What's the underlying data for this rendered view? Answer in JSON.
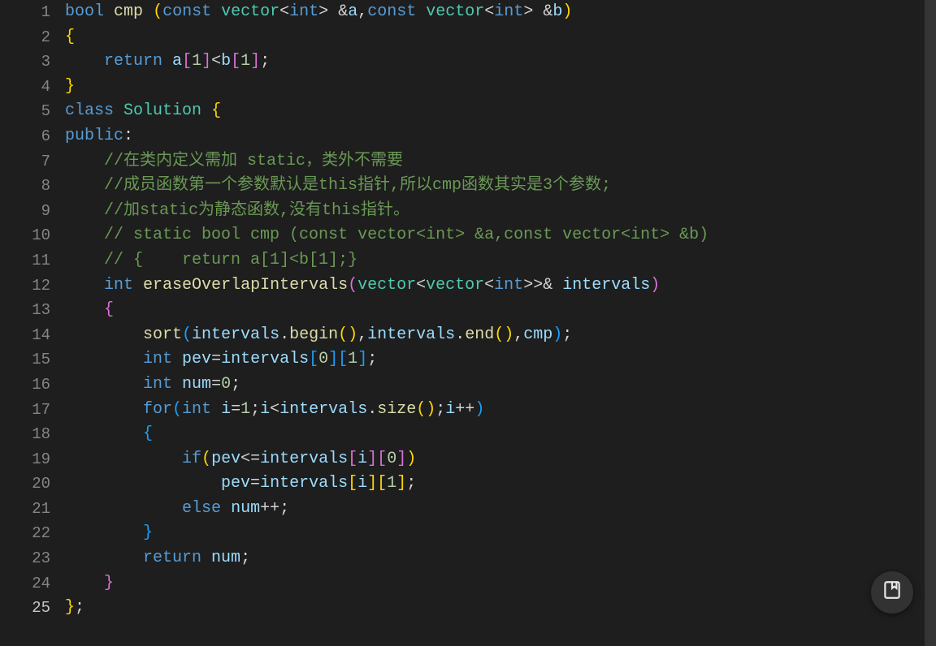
{
  "fab_icon": "bookmark-icon",
  "active_line": 25,
  "lines": [
    {
      "n": 1,
      "tokens": [
        {
          "t": "bool",
          "c": "kw"
        },
        {
          "t": " ",
          "c": "op"
        },
        {
          "t": "cmp",
          "c": "fn"
        },
        {
          "t": " ",
          "c": "op"
        },
        {
          "t": "(",
          "c": "br-y"
        },
        {
          "t": "const",
          "c": "kw"
        },
        {
          "t": " ",
          "c": "op"
        },
        {
          "t": "vector",
          "c": "type"
        },
        {
          "t": "<",
          "c": "op"
        },
        {
          "t": "int",
          "c": "kw"
        },
        {
          "t": ">",
          "c": "op"
        },
        {
          "t": " ",
          "c": "op"
        },
        {
          "t": "&",
          "c": "op"
        },
        {
          "t": "a",
          "c": "var"
        },
        {
          "t": ",",
          "c": "pun"
        },
        {
          "t": "const",
          "c": "kw"
        },
        {
          "t": " ",
          "c": "op"
        },
        {
          "t": "vector",
          "c": "type"
        },
        {
          "t": "<",
          "c": "op"
        },
        {
          "t": "int",
          "c": "kw"
        },
        {
          "t": ">",
          "c": "op"
        },
        {
          "t": " ",
          "c": "op"
        },
        {
          "t": "&",
          "c": "op"
        },
        {
          "t": "b",
          "c": "var"
        },
        {
          "t": ")",
          "c": "br-y"
        }
      ]
    },
    {
      "n": 2,
      "tokens": [
        {
          "t": "{",
          "c": "br-y"
        }
      ]
    },
    {
      "n": 3,
      "tokens": [
        {
          "t": "    ",
          "c": "op"
        },
        {
          "t": "return",
          "c": "kw"
        },
        {
          "t": " ",
          "c": "op"
        },
        {
          "t": "a",
          "c": "var"
        },
        {
          "t": "[",
          "c": "br-p"
        },
        {
          "t": "1",
          "c": "num"
        },
        {
          "t": "]",
          "c": "br-p"
        },
        {
          "t": "<",
          "c": "op"
        },
        {
          "t": "b",
          "c": "var"
        },
        {
          "t": "[",
          "c": "br-p"
        },
        {
          "t": "1",
          "c": "num"
        },
        {
          "t": "]",
          "c": "br-p"
        },
        {
          "t": ";",
          "c": "pun"
        }
      ]
    },
    {
      "n": 4,
      "tokens": [
        {
          "t": "}",
          "c": "br-y"
        }
      ]
    },
    {
      "n": 5,
      "tokens": [
        {
          "t": "class",
          "c": "kw"
        },
        {
          "t": " ",
          "c": "op"
        },
        {
          "t": "Solution",
          "c": "type"
        },
        {
          "t": " ",
          "c": "op"
        },
        {
          "t": "{",
          "c": "br-y"
        }
      ]
    },
    {
      "n": 6,
      "tokens": [
        {
          "t": "public",
          "c": "kw"
        },
        {
          "t": ":",
          "c": "pun"
        }
      ]
    },
    {
      "n": 7,
      "tokens": [
        {
          "t": "    ",
          "c": "op"
        },
        {
          "t": "//在类内定义需加 static，类外不需要",
          "c": "cmt"
        }
      ]
    },
    {
      "n": 8,
      "tokens": [
        {
          "t": "    ",
          "c": "op"
        },
        {
          "t": "//成员函数第一个参数默认是this指针,所以cmp函数其实是3个参数;",
          "c": "cmt"
        }
      ]
    },
    {
      "n": 9,
      "tokens": [
        {
          "t": "    ",
          "c": "op"
        },
        {
          "t": "//加static为静态函数,没有this指针。",
          "c": "cmt"
        }
      ]
    },
    {
      "n": 10,
      "tokens": [
        {
          "t": "    ",
          "c": "op"
        },
        {
          "t": "// static bool cmp (const vector<int> &a,const vector<int> &b)",
          "c": "cmt"
        }
      ]
    },
    {
      "n": 11,
      "tokens": [
        {
          "t": "    ",
          "c": "op"
        },
        {
          "t": "// {    return a[1]<b[1];}",
          "c": "cmt"
        }
      ]
    },
    {
      "n": 12,
      "tokens": [
        {
          "t": "    ",
          "c": "op"
        },
        {
          "t": "int",
          "c": "kw"
        },
        {
          "t": " ",
          "c": "op"
        },
        {
          "t": "eraseOverlapIntervals",
          "c": "fn"
        },
        {
          "t": "(",
          "c": "br-p"
        },
        {
          "t": "vector",
          "c": "type"
        },
        {
          "t": "<",
          "c": "op"
        },
        {
          "t": "vector",
          "c": "type"
        },
        {
          "t": "<",
          "c": "op"
        },
        {
          "t": "int",
          "c": "kw"
        },
        {
          "t": ">>",
          "c": "op"
        },
        {
          "t": "&",
          "c": "op"
        },
        {
          "t": " ",
          "c": "op"
        },
        {
          "t": "intervals",
          "c": "var"
        },
        {
          "t": ")",
          "c": "br-p"
        }
      ]
    },
    {
      "n": 13,
      "tokens": [
        {
          "t": "    ",
          "c": "op"
        },
        {
          "t": "{",
          "c": "br-p"
        }
      ]
    },
    {
      "n": 14,
      "tokens": [
        {
          "t": "        ",
          "c": "op"
        },
        {
          "t": "sort",
          "c": "fn"
        },
        {
          "t": "(",
          "c": "br-b"
        },
        {
          "t": "intervals",
          "c": "var"
        },
        {
          "t": ".",
          "c": "pun"
        },
        {
          "t": "begin",
          "c": "fn"
        },
        {
          "t": "(",
          "c": "br-y"
        },
        {
          "t": ")",
          "c": "br-y"
        },
        {
          "t": ",",
          "c": "pun"
        },
        {
          "t": "intervals",
          "c": "var"
        },
        {
          "t": ".",
          "c": "pun"
        },
        {
          "t": "end",
          "c": "fn"
        },
        {
          "t": "(",
          "c": "br-y"
        },
        {
          "t": ")",
          "c": "br-y"
        },
        {
          "t": ",",
          "c": "pun"
        },
        {
          "t": "cmp",
          "c": "var"
        },
        {
          "t": ")",
          "c": "br-b"
        },
        {
          "t": ";",
          "c": "pun"
        }
      ]
    },
    {
      "n": 15,
      "tokens": [
        {
          "t": "        ",
          "c": "op"
        },
        {
          "t": "int",
          "c": "kw"
        },
        {
          "t": " ",
          "c": "op"
        },
        {
          "t": "pev",
          "c": "var"
        },
        {
          "t": "=",
          "c": "op"
        },
        {
          "t": "intervals",
          "c": "var"
        },
        {
          "t": "[",
          "c": "br-b"
        },
        {
          "t": "0",
          "c": "num"
        },
        {
          "t": "]",
          "c": "br-b"
        },
        {
          "t": "[",
          "c": "br-b"
        },
        {
          "t": "1",
          "c": "num"
        },
        {
          "t": "]",
          "c": "br-b"
        },
        {
          "t": ";",
          "c": "pun"
        }
      ]
    },
    {
      "n": 16,
      "tokens": [
        {
          "t": "        ",
          "c": "op"
        },
        {
          "t": "int",
          "c": "kw"
        },
        {
          "t": " ",
          "c": "op"
        },
        {
          "t": "num",
          "c": "var"
        },
        {
          "t": "=",
          "c": "op"
        },
        {
          "t": "0",
          "c": "num"
        },
        {
          "t": ";",
          "c": "pun"
        }
      ]
    },
    {
      "n": 17,
      "tokens": [
        {
          "t": "        ",
          "c": "op"
        },
        {
          "t": "for",
          "c": "kw"
        },
        {
          "t": "(",
          "c": "br-b"
        },
        {
          "t": "int",
          "c": "kw"
        },
        {
          "t": " ",
          "c": "op"
        },
        {
          "t": "i",
          "c": "var"
        },
        {
          "t": "=",
          "c": "op"
        },
        {
          "t": "1",
          "c": "num"
        },
        {
          "t": ";",
          "c": "pun"
        },
        {
          "t": "i",
          "c": "var"
        },
        {
          "t": "<",
          "c": "op"
        },
        {
          "t": "intervals",
          "c": "var"
        },
        {
          "t": ".",
          "c": "pun"
        },
        {
          "t": "size",
          "c": "fn"
        },
        {
          "t": "(",
          "c": "br-y"
        },
        {
          "t": ")",
          "c": "br-y"
        },
        {
          "t": ";",
          "c": "pun"
        },
        {
          "t": "i",
          "c": "var"
        },
        {
          "t": "++",
          "c": "op"
        },
        {
          "t": ")",
          "c": "br-b"
        }
      ]
    },
    {
      "n": 18,
      "tokens": [
        {
          "t": "        ",
          "c": "op"
        },
        {
          "t": "{",
          "c": "br-b"
        }
      ]
    },
    {
      "n": 19,
      "tokens": [
        {
          "t": "            ",
          "c": "op"
        },
        {
          "t": "if",
          "c": "kw"
        },
        {
          "t": "(",
          "c": "br-y"
        },
        {
          "t": "pev",
          "c": "var"
        },
        {
          "t": "<=",
          "c": "op"
        },
        {
          "t": "intervals",
          "c": "var"
        },
        {
          "t": "[",
          "c": "br-p"
        },
        {
          "t": "i",
          "c": "var"
        },
        {
          "t": "]",
          "c": "br-p"
        },
        {
          "t": "[",
          "c": "br-p"
        },
        {
          "t": "0",
          "c": "num"
        },
        {
          "t": "]",
          "c": "br-p"
        },
        {
          "t": ")",
          "c": "br-y"
        }
      ]
    },
    {
      "n": 20,
      "tokens": [
        {
          "t": "                ",
          "c": "op"
        },
        {
          "t": "pev",
          "c": "var"
        },
        {
          "t": "=",
          "c": "op"
        },
        {
          "t": "intervals",
          "c": "var"
        },
        {
          "t": "[",
          "c": "br-y"
        },
        {
          "t": "i",
          "c": "var"
        },
        {
          "t": "]",
          "c": "br-y"
        },
        {
          "t": "[",
          "c": "br-y"
        },
        {
          "t": "1",
          "c": "num"
        },
        {
          "t": "]",
          "c": "br-y"
        },
        {
          "t": ";",
          "c": "pun"
        }
      ]
    },
    {
      "n": 21,
      "tokens": [
        {
          "t": "            ",
          "c": "op"
        },
        {
          "t": "else",
          "c": "kw"
        },
        {
          "t": " ",
          "c": "op"
        },
        {
          "t": "num",
          "c": "var"
        },
        {
          "t": "++",
          "c": "op"
        },
        {
          "t": ";",
          "c": "pun"
        }
      ]
    },
    {
      "n": 22,
      "tokens": [
        {
          "t": "        ",
          "c": "op"
        },
        {
          "t": "}",
          "c": "br-b"
        }
      ]
    },
    {
      "n": 23,
      "tokens": [
        {
          "t": "        ",
          "c": "op"
        },
        {
          "t": "return",
          "c": "kw"
        },
        {
          "t": " ",
          "c": "op"
        },
        {
          "t": "num",
          "c": "var"
        },
        {
          "t": ";",
          "c": "pun"
        }
      ]
    },
    {
      "n": 24,
      "tokens": [
        {
          "t": "    ",
          "c": "op"
        },
        {
          "t": "}",
          "c": "br-p"
        }
      ]
    },
    {
      "n": 25,
      "tokens": [
        {
          "t": "}",
          "c": "br-y"
        },
        {
          "t": ";",
          "c": "pun"
        }
      ]
    }
  ]
}
